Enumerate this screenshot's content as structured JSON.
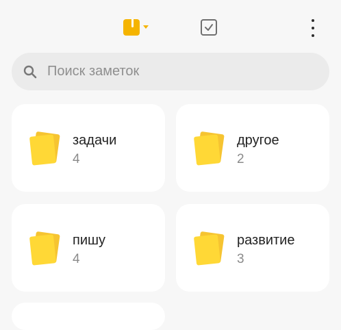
{
  "toolbar": {
    "notes_icon": "notes-icon",
    "dropdown_icon": "chevron-down-icon",
    "tasks_icon": "checkbox-icon",
    "more_icon": "more-vertical-icon"
  },
  "search": {
    "placeholder": "Поиск заметок",
    "icon": "search-icon"
  },
  "folders": [
    {
      "name": "задачи",
      "count": "4"
    },
    {
      "name": "другое",
      "count": "2"
    },
    {
      "name": "пишу",
      "count": "4"
    },
    {
      "name": "развитие",
      "count": "3"
    }
  ],
  "colors": {
    "accent": "#f5b400",
    "folder_back": "#f6c431",
    "folder_front": "#ffd836",
    "background": "#f7f7f7",
    "card": "#ffffff",
    "search_bg": "#ebebeb"
  }
}
